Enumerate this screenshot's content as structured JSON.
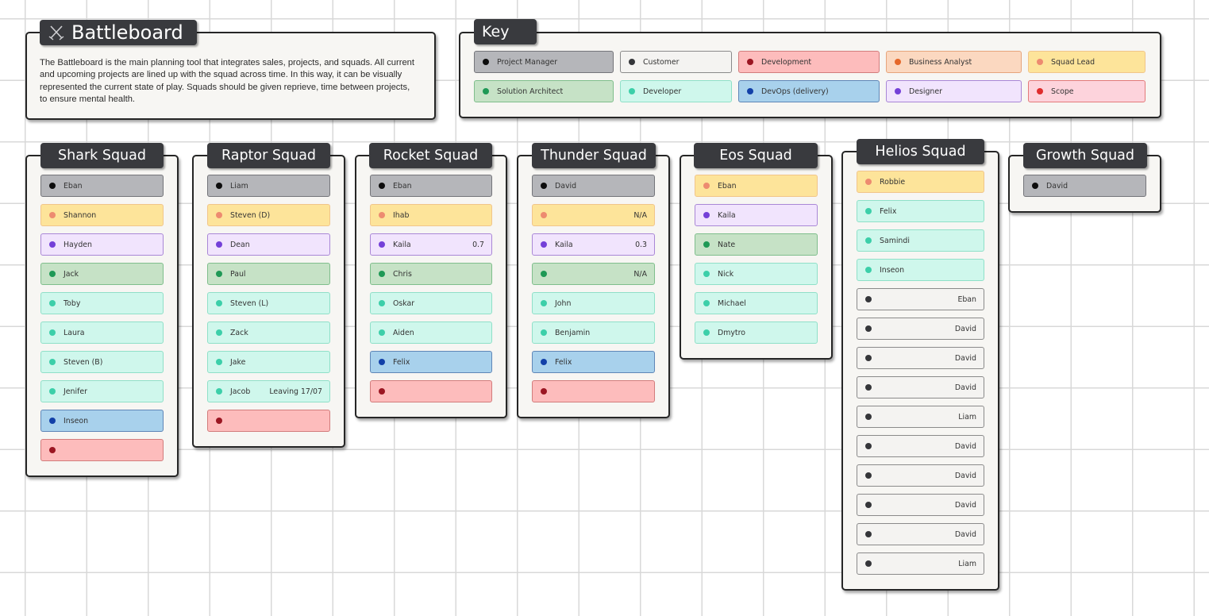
{
  "intro": {
    "title": "Battleboard",
    "title_icon": "crossed-swords-icon",
    "description": "The Battleboard is the main planning tool that integrates sales, projects, and squads. All current and upcoming projects are lined up with the squad across time. In this way, it can be visually represented the current state of play. Squads should be given reprieve, time between projects, to ensure mental health."
  },
  "key": {
    "title": "Key",
    "items": [
      {
        "role": "pm",
        "label": "Project Manager",
        "color": "#0d0d0d"
      },
      {
        "role": "cust",
        "label": "Customer",
        "color": "#35363a"
      },
      {
        "role": "dev",
        "label": "Development",
        "color": "#9b1622"
      },
      {
        "role": "ba",
        "label": "Business Analyst",
        "color": "#e5682a"
      },
      {
        "role": "sl",
        "label": "Squad Lead",
        "color": "#ed8b70"
      },
      {
        "role": "sa",
        "label": "Solution Architect",
        "color": "#1f9956"
      },
      {
        "role": "de",
        "label": "Developer",
        "color": "#3ccfa9"
      },
      {
        "role": "ops",
        "label": "DevOps (delivery)",
        "color": "#1240a8"
      },
      {
        "role": "ds",
        "label": "Designer",
        "color": "#7440d8"
      },
      {
        "role": "sc",
        "label": "Scope",
        "color": "#df2d2d"
      }
    ]
  },
  "squads": [
    {
      "name": "Shark Squad",
      "members": [
        {
          "role": "pm",
          "name": "Eban",
          "note": ""
        },
        {
          "role": "sl",
          "name": "Shannon",
          "note": ""
        },
        {
          "role": "ds",
          "name": "Hayden",
          "note": ""
        },
        {
          "role": "sa",
          "name": "Jack",
          "note": ""
        },
        {
          "role": "de",
          "name": "Toby",
          "note": ""
        },
        {
          "role": "de",
          "name": "Laura",
          "note": ""
        },
        {
          "role": "de",
          "name": "Steven (B)",
          "note": ""
        },
        {
          "role": "de",
          "name": "Jenifer",
          "note": ""
        },
        {
          "role": "ops",
          "name": "Inseon",
          "note": ""
        },
        {
          "role": "dev",
          "name": "",
          "note": ""
        }
      ]
    },
    {
      "name": "Raptor Squad",
      "members": [
        {
          "role": "pm",
          "name": "Liam",
          "note": ""
        },
        {
          "role": "sl",
          "name": "Steven (D)",
          "note": ""
        },
        {
          "role": "ds",
          "name": "Dean",
          "note": ""
        },
        {
          "role": "sa",
          "name": "Paul",
          "note": ""
        },
        {
          "role": "de",
          "name": "Steven (L)",
          "note": ""
        },
        {
          "role": "de",
          "name": "Zack",
          "note": ""
        },
        {
          "role": "de",
          "name": "Jake",
          "note": ""
        },
        {
          "role": "de",
          "name": "Jacob",
          "note": "Leaving 17/07"
        },
        {
          "role": "dev",
          "name": "",
          "note": ""
        }
      ]
    },
    {
      "name": "Rocket Squad",
      "members": [
        {
          "role": "pm",
          "name": "Eban",
          "note": ""
        },
        {
          "role": "sl",
          "name": "Ihab",
          "note": ""
        },
        {
          "role": "ds",
          "name": "Kaila",
          "note": "0.7"
        },
        {
          "role": "sa",
          "name": "Chris",
          "note": ""
        },
        {
          "role": "de",
          "name": "Oskar",
          "note": ""
        },
        {
          "role": "de",
          "name": "Aiden",
          "note": ""
        },
        {
          "role": "ops",
          "name": "Felix",
          "note": ""
        },
        {
          "role": "dev",
          "name": "",
          "note": ""
        }
      ]
    },
    {
      "name": "Thunder Squad",
      "members": [
        {
          "role": "pm",
          "name": "David",
          "note": ""
        },
        {
          "role": "sl",
          "name": "",
          "note": "N/A"
        },
        {
          "role": "ds",
          "name": "Kaila",
          "note": "0.3"
        },
        {
          "role": "sa",
          "name": "",
          "note": "N/A"
        },
        {
          "role": "de",
          "name": "John",
          "note": ""
        },
        {
          "role": "de",
          "name": "Benjamin",
          "note": ""
        },
        {
          "role": "ops",
          "name": "Felix",
          "note": ""
        },
        {
          "role": "dev",
          "name": "",
          "note": ""
        }
      ]
    },
    {
      "name": "Eos Squad",
      "members": [
        {
          "role": "sl",
          "name": "Eban",
          "note": ""
        },
        {
          "role": "ds",
          "name": "Kaila",
          "note": ""
        },
        {
          "role": "sa",
          "name": "Nate",
          "note": ""
        },
        {
          "role": "de",
          "name": "Nick",
          "note": ""
        },
        {
          "role": "de",
          "name": "Michael",
          "note": ""
        },
        {
          "role": "de",
          "name": "Dmytro",
          "note": ""
        }
      ]
    },
    {
      "name": "Helios Squad",
      "members": [
        {
          "role": "sl",
          "name": "Robbie",
          "note": ""
        },
        {
          "role": "de",
          "name": "Felix",
          "note": ""
        },
        {
          "role": "de",
          "name": "Samindi",
          "note": ""
        },
        {
          "role": "de",
          "name": "Inseon",
          "note": ""
        },
        {
          "role": "cust",
          "name": "",
          "note": "Eban"
        },
        {
          "role": "cust",
          "name": "",
          "note": "David"
        },
        {
          "role": "cust",
          "name": "",
          "note": "David"
        },
        {
          "role": "cust",
          "name": "",
          "note": "David"
        },
        {
          "role": "cust",
          "name": "",
          "note": "Liam"
        },
        {
          "role": "cust",
          "name": "",
          "note": "David"
        },
        {
          "role": "cust",
          "name": "",
          "note": "David"
        },
        {
          "role": "cust",
          "name": "",
          "note": "David"
        },
        {
          "role": "cust",
          "name": "",
          "note": "David"
        },
        {
          "role": "cust",
          "name": "",
          "note": "Liam"
        }
      ]
    },
    {
      "name": "Growth Squad",
      "members": [
        {
          "role": "pm",
          "name": "David",
          "note": ""
        }
      ]
    }
  ]
}
